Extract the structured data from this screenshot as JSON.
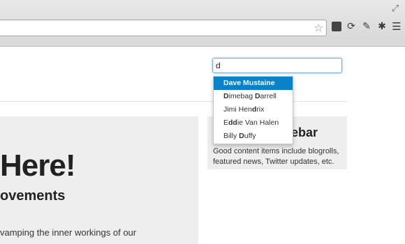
{
  "browser": {
    "search_input_value": "d",
    "icons": {
      "bookmark": "star-icon",
      "extension_1": "extension-icon",
      "extension_2": "sync-icon",
      "extension_3": "puzzle-icon",
      "extension_4": "bug-icon",
      "menu": "menu-icon",
      "fullscreen": "expand-icon"
    }
  },
  "hero": {
    "title": "Here!",
    "subtitle": "ovements",
    "body": "vamping the inner workings of our"
  },
  "sidebar": {
    "title": "ebar",
    "text": "Good content items include blogrolls, featured news, Twitter updates, etc."
  },
  "autocomplete": {
    "items": [
      {
        "pre": "",
        "match": "D",
        "mid": "ave Mustaine",
        "match2": "",
        "post": ""
      },
      {
        "pre": "",
        "match": "D",
        "mid": "imebag ",
        "match2": "D",
        "post": "arrell"
      },
      {
        "pre": "Jimi Hen",
        "match": "d",
        "mid": "rix",
        "match2": "",
        "post": ""
      },
      {
        "pre": "E",
        "match": "dd",
        "mid": "ie Van Halen",
        "match2": "",
        "post": ""
      },
      {
        "pre": "Billy ",
        "match": "D",
        "mid": "uffy",
        "match2": "",
        "post": ""
      }
    ],
    "active_index": 0
  }
}
